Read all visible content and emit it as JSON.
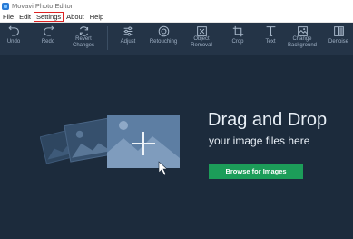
{
  "window": {
    "title": "Movavi Photo Editor"
  },
  "menu": {
    "file": "File",
    "edit": "Edit",
    "settings": "Settings",
    "about": "About",
    "help": "Help"
  },
  "toolbar": {
    "undo": "Undo",
    "redo": "Redo",
    "revert_line1": "Revert",
    "revert_line2": "Changes",
    "adjust": "Adjust",
    "retouching": "Retouching",
    "object_line1": "Object",
    "object_line2": "Removal",
    "crop": "Crop",
    "text": "Text",
    "change_line1": "Change",
    "change_line2": "Background",
    "denoise": "Denoise"
  },
  "main": {
    "headline": "Drag and Drop",
    "subline": "your image files here",
    "browse_button": "Browse for Images"
  },
  "colors": {
    "background": "#1c2b3c",
    "toolbar": "#243447",
    "accent_green": "#1c9d59",
    "settings_highlight": "#d22222"
  }
}
